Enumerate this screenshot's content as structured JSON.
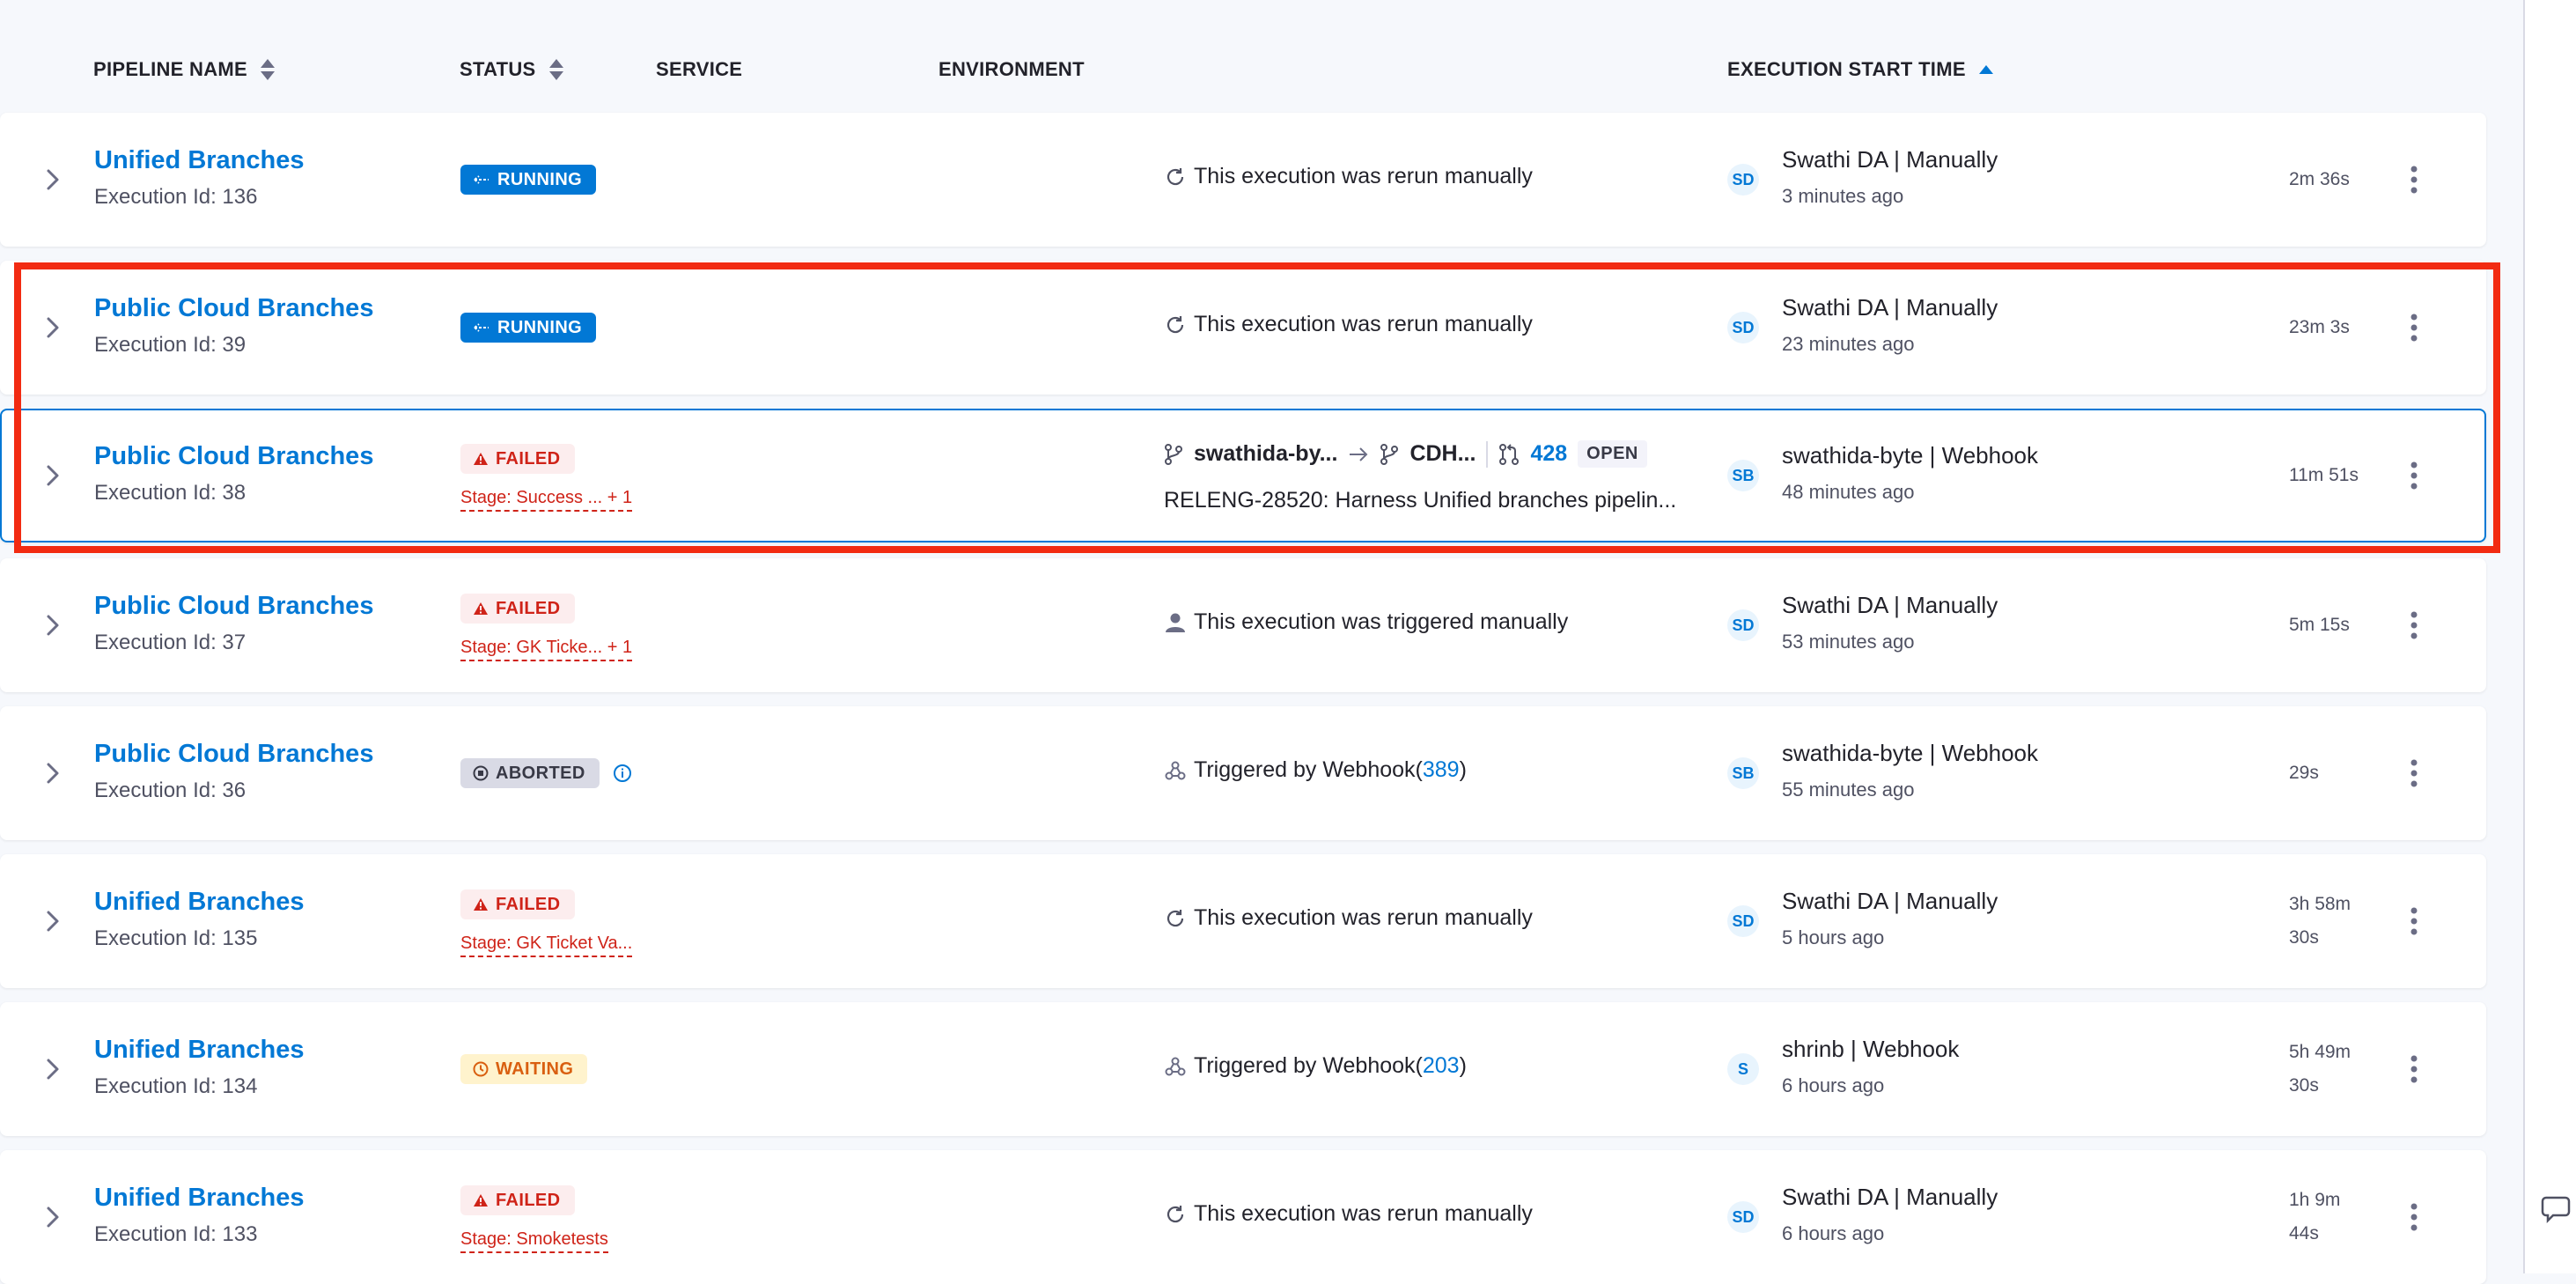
{
  "header": {
    "pipeline_name": "PIPELINE NAME",
    "status": "STATUS",
    "service": "SERVICE",
    "environment": "ENVIRONMENT",
    "execution_start_time": "EXECUTION START TIME"
  },
  "rows": [
    {
      "name": "Unified Branches",
      "exec": "Execution Id: 136",
      "status": "RUNNING",
      "trigger": "This execution was rerun manually",
      "avatar": "SD",
      "user": "Swathi DA | Manually",
      "ago": "3 minutes ago",
      "duration": "2m 36s"
    },
    {
      "name": "Public Cloud Branches",
      "exec": "Execution Id: 39",
      "status": "RUNNING",
      "trigger": "This execution was rerun manually",
      "avatar": "SD",
      "user": "Swathi DA | Manually",
      "ago": "23 minutes ago",
      "duration": "23m 3s"
    },
    {
      "name": "Public Cloud Branches",
      "exec": "Execution Id: 38",
      "status": "FAILED",
      "stage": "Stage: Success ...  + 1",
      "git": {
        "source": "swathida-by...",
        "target": "CDH...",
        "pr": "428",
        "state": "OPEN"
      },
      "commit": "RELENG-28520: Harness Unified branches pipelin...",
      "avatar": "SB",
      "user": "swathida-byte | Webhook",
      "ago": "48 minutes ago",
      "duration": "11m 51s"
    },
    {
      "name": "Public Cloud Branches",
      "exec": "Execution Id: 37",
      "status": "FAILED",
      "stage": "Stage: GK Ticke...  + 1",
      "trigger": "This execution was triggered manually",
      "avatar": "SD",
      "user": "Swathi DA | Manually",
      "ago": "53 minutes ago",
      "duration": "5m 15s"
    },
    {
      "name": "Public Cloud Branches",
      "exec": "Execution Id: 36",
      "status": "ABORTED",
      "trigger_prefix": "Triggered by Webhook(",
      "trigger_link": "389",
      "trigger_suffix": ")",
      "avatar": "SB",
      "user": "swathida-byte | Webhook",
      "ago": "55 minutes ago",
      "duration": "29s"
    },
    {
      "name": "Unified Branches",
      "exec": "Execution Id: 135",
      "status": "FAILED",
      "stage": "Stage: GK Ticket Va...",
      "trigger": "This execution was rerun manually",
      "avatar": "SD",
      "user": "Swathi DA | Manually",
      "ago": "5 hours ago",
      "duration_l1": "3h 58m",
      "duration_l2": "30s"
    },
    {
      "name": "Unified Branches",
      "exec": "Execution Id: 134",
      "status": "WAITING",
      "trigger_prefix": "Triggered by Webhook(",
      "trigger_link": "203",
      "trigger_suffix": ")",
      "avatar": "S",
      "user": "shrinb | Webhook",
      "ago": "6 hours ago",
      "duration_l1": "5h 49m",
      "duration_l2": "30s"
    },
    {
      "name": "Unified Branches",
      "exec": "Execution Id: 133",
      "status": "FAILED",
      "stage": "Stage: Smoketests",
      "trigger": "This execution was rerun manually",
      "avatar": "SD",
      "user": "Swathi DA | Manually",
      "ago": "6 hours ago",
      "duration_l1": "1h 9m",
      "duration_l2": "44s"
    }
  ],
  "colors": {
    "link": "#0278d5",
    "failed": "#cf2318",
    "highlight": "#f22b12",
    "waiting": "#d95f10"
  },
  "icons": [
    "sort-icon",
    "sort-asc-icon",
    "chevron-right-icon",
    "rerun-icon",
    "user-icon",
    "webhook-icon",
    "branch-icon",
    "arrow-right-icon",
    "pull-request-icon",
    "info-icon",
    "kebab-menu-icon",
    "warning-icon",
    "clock-icon",
    "stop-icon",
    "running-icon",
    "chat-icon"
  ]
}
